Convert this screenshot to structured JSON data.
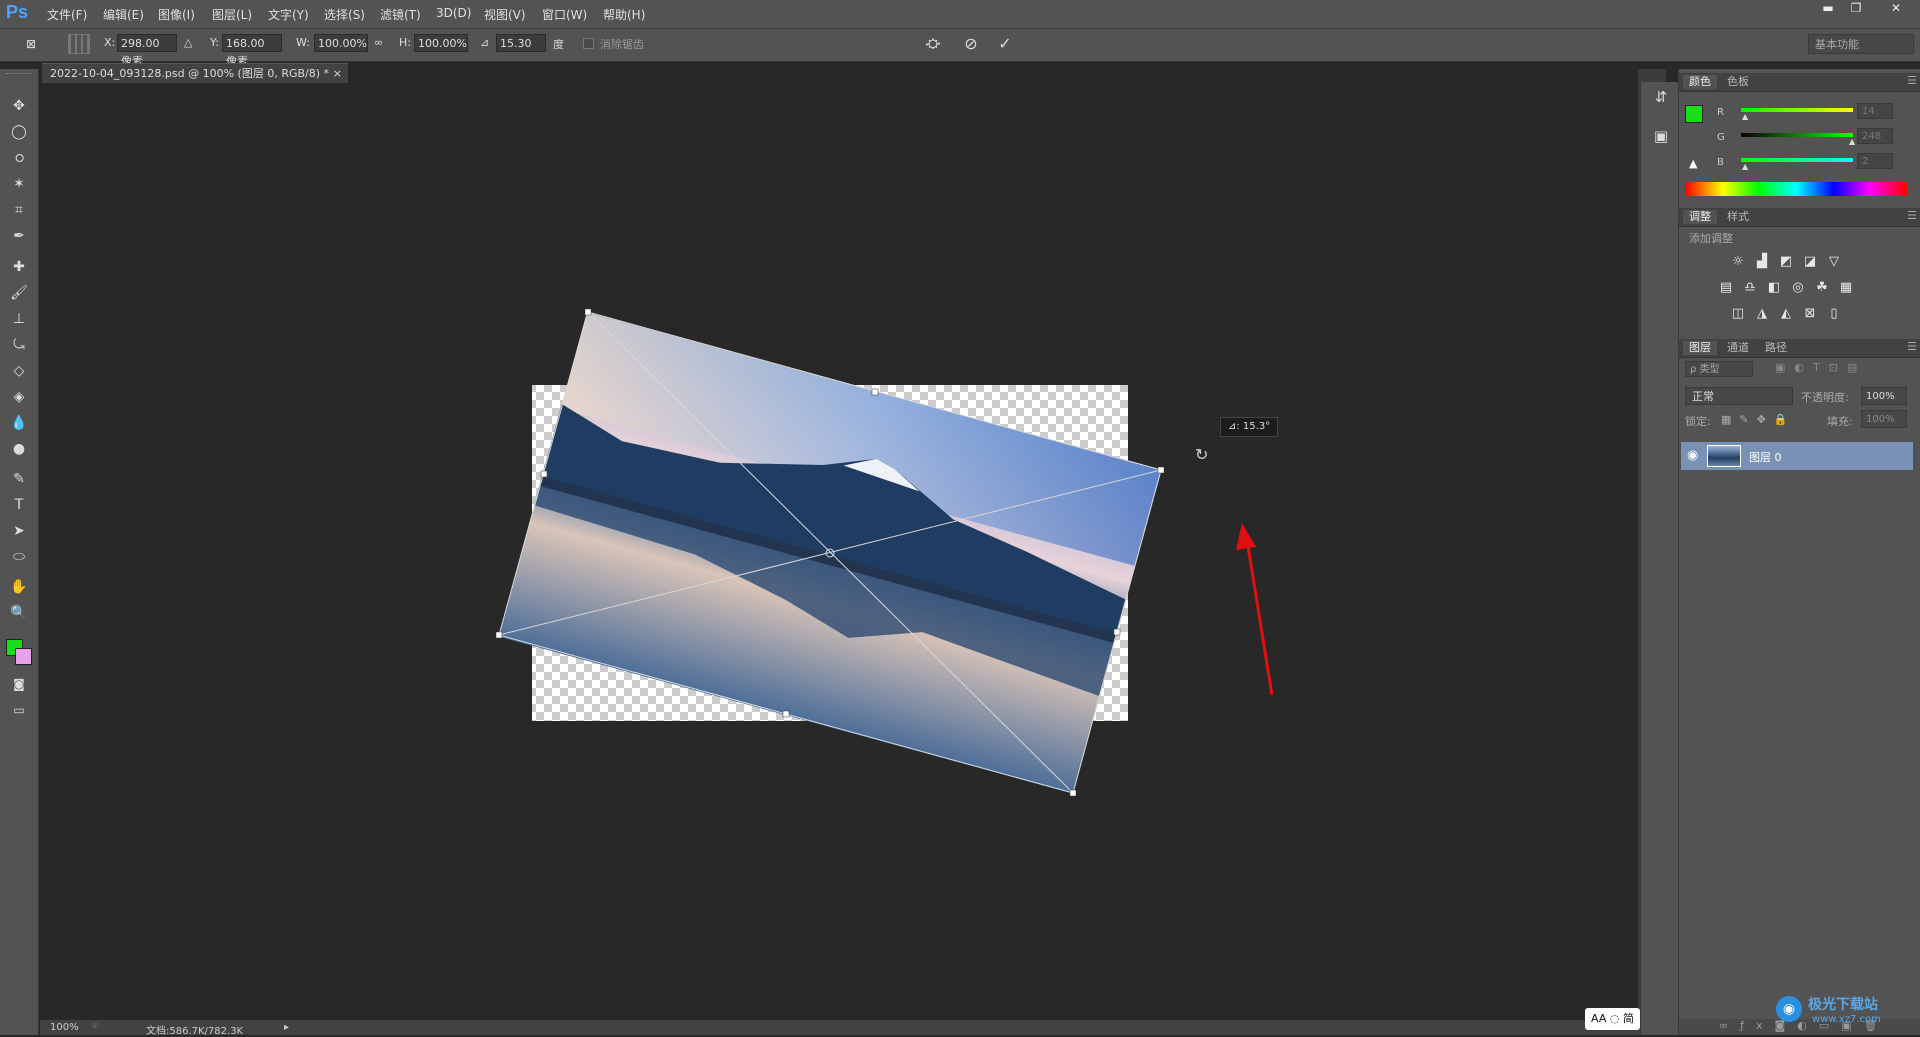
{
  "app": {
    "logo": "Ps"
  },
  "menu": [
    "文件(F)",
    "编辑(E)",
    "图像(I)",
    "图层(L)",
    "文字(Y)",
    "选择(S)",
    "滤镜(T)",
    "3D(D)",
    "视图(V)",
    "窗口(W)",
    "帮助(H)"
  ],
  "window_controls": {
    "minimize": "▬",
    "restore": "❐",
    "close": "✕"
  },
  "options": {
    "x_label": "X:",
    "x_value": "298.00 像素",
    "y_label": "Y:",
    "y_value": "168.00 像素",
    "w_label": "W:",
    "w_value": "100.00%",
    "h_label": "H:",
    "h_value": "100.00%",
    "angle_value": "15.30",
    "angle_unit": "度",
    "interp_label": "消除锯齿",
    "workspace": "基本功能"
  },
  "document": {
    "tab_title": "2022-10-04_093128.psd @ 100% (图层 0, RGB/8) *",
    "close": "×"
  },
  "rotation_tooltip": "⊿: 15.3°",
  "tools": [
    "move-icon",
    "marquee-icon",
    "lasso-icon",
    "magic-wand-icon",
    "crop-icon",
    "eyedropper-icon",
    "healing-icon",
    "brush-icon",
    "stamp-icon",
    "history-brush-icon",
    "eraser-icon",
    "bucket-icon",
    "blur-icon",
    "dodge-icon",
    "pen-icon",
    "type-icon",
    "path-select-icon",
    "shape-icon",
    "hand-icon",
    "zoom-icon"
  ],
  "tool_glyphs": [
    "✥",
    "◯",
    "ഠ",
    "✶",
    "⌗",
    "✒",
    "✚",
    "🖌",
    "⊥",
    "⤿",
    "◇",
    "◈",
    "💧",
    "●",
    "✎",
    "T",
    "➤",
    "⬭",
    "✋",
    "🔍"
  ],
  "colors": {
    "foreground": "#18e018",
    "background": "#e8a0e8",
    "accent_arrow": "#e01010"
  },
  "color_panel": {
    "tabs": [
      "颜色",
      "色板"
    ],
    "channels": [
      {
        "label": "R",
        "value": "14"
      },
      {
        "label": "G",
        "value": "248"
      },
      {
        "label": "B",
        "value": "2"
      }
    ]
  },
  "adjust_panel": {
    "tabs": [
      "调整",
      "样式"
    ],
    "subtitle": "添加调整"
  },
  "layers_panel": {
    "tabs": [
      "图层",
      "通道",
      "路径"
    ],
    "filter_label": "ρ 类型",
    "blend_mode": "正常",
    "opacity_label": "不透明度:",
    "opacity_value": "100%",
    "lock_label": "锁定:",
    "fill_label": "填充:",
    "fill_value": "100%",
    "layers": [
      {
        "name": "图层 0",
        "visible": true
      }
    ]
  },
  "status": {
    "zoom": "100%",
    "doc_info": "文档:586.7K/782.3K"
  },
  "ime": {
    "label": "AA ◌ 简"
  },
  "watermark": {
    "text": "极光下载站",
    "url": "www.xz7.com"
  }
}
